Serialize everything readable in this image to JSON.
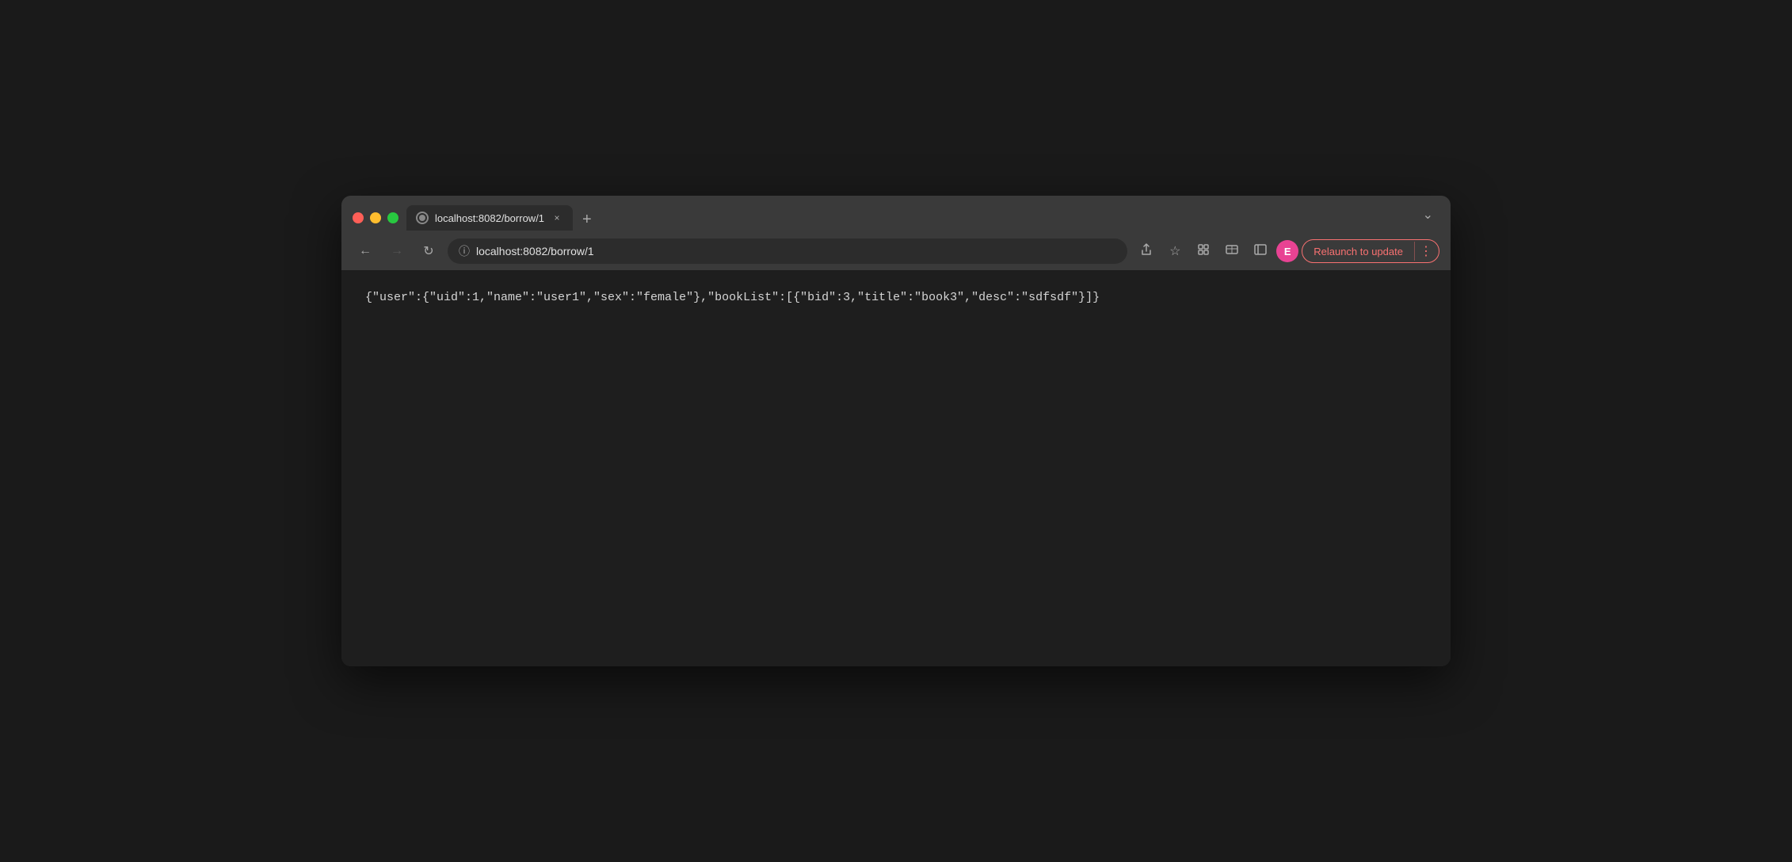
{
  "window": {
    "controls": {
      "close_label": "",
      "minimize_label": "",
      "maximize_label": ""
    }
  },
  "tab": {
    "favicon_alt": "globe-icon",
    "title": "localhost:8082/borrow/1",
    "close_label": "×",
    "new_tab_label": "+"
  },
  "tabs_chevron": "∨",
  "nav": {
    "back_label": "←",
    "forward_label": "→",
    "reload_label": "↻",
    "address": "localhost:8082/borrow/1",
    "info_icon": "ℹ"
  },
  "toolbar": {
    "share_icon": "share",
    "bookmark_icon": "☆",
    "extensions_icon": "⬡",
    "media_icon": "⊞",
    "sidebar_icon": "▣",
    "profile_letter": "E",
    "relaunch_label": "Relaunch to update",
    "more_label": "⋮"
  },
  "page": {
    "json_content": "{\"user\":{\"uid\":1,\"name\":\"user1\",\"sex\":\"female\"},\"bookList\":[{\"bid\":3,\"title\":\"book3\",\"desc\":\"sdfsdf\"}]}"
  }
}
